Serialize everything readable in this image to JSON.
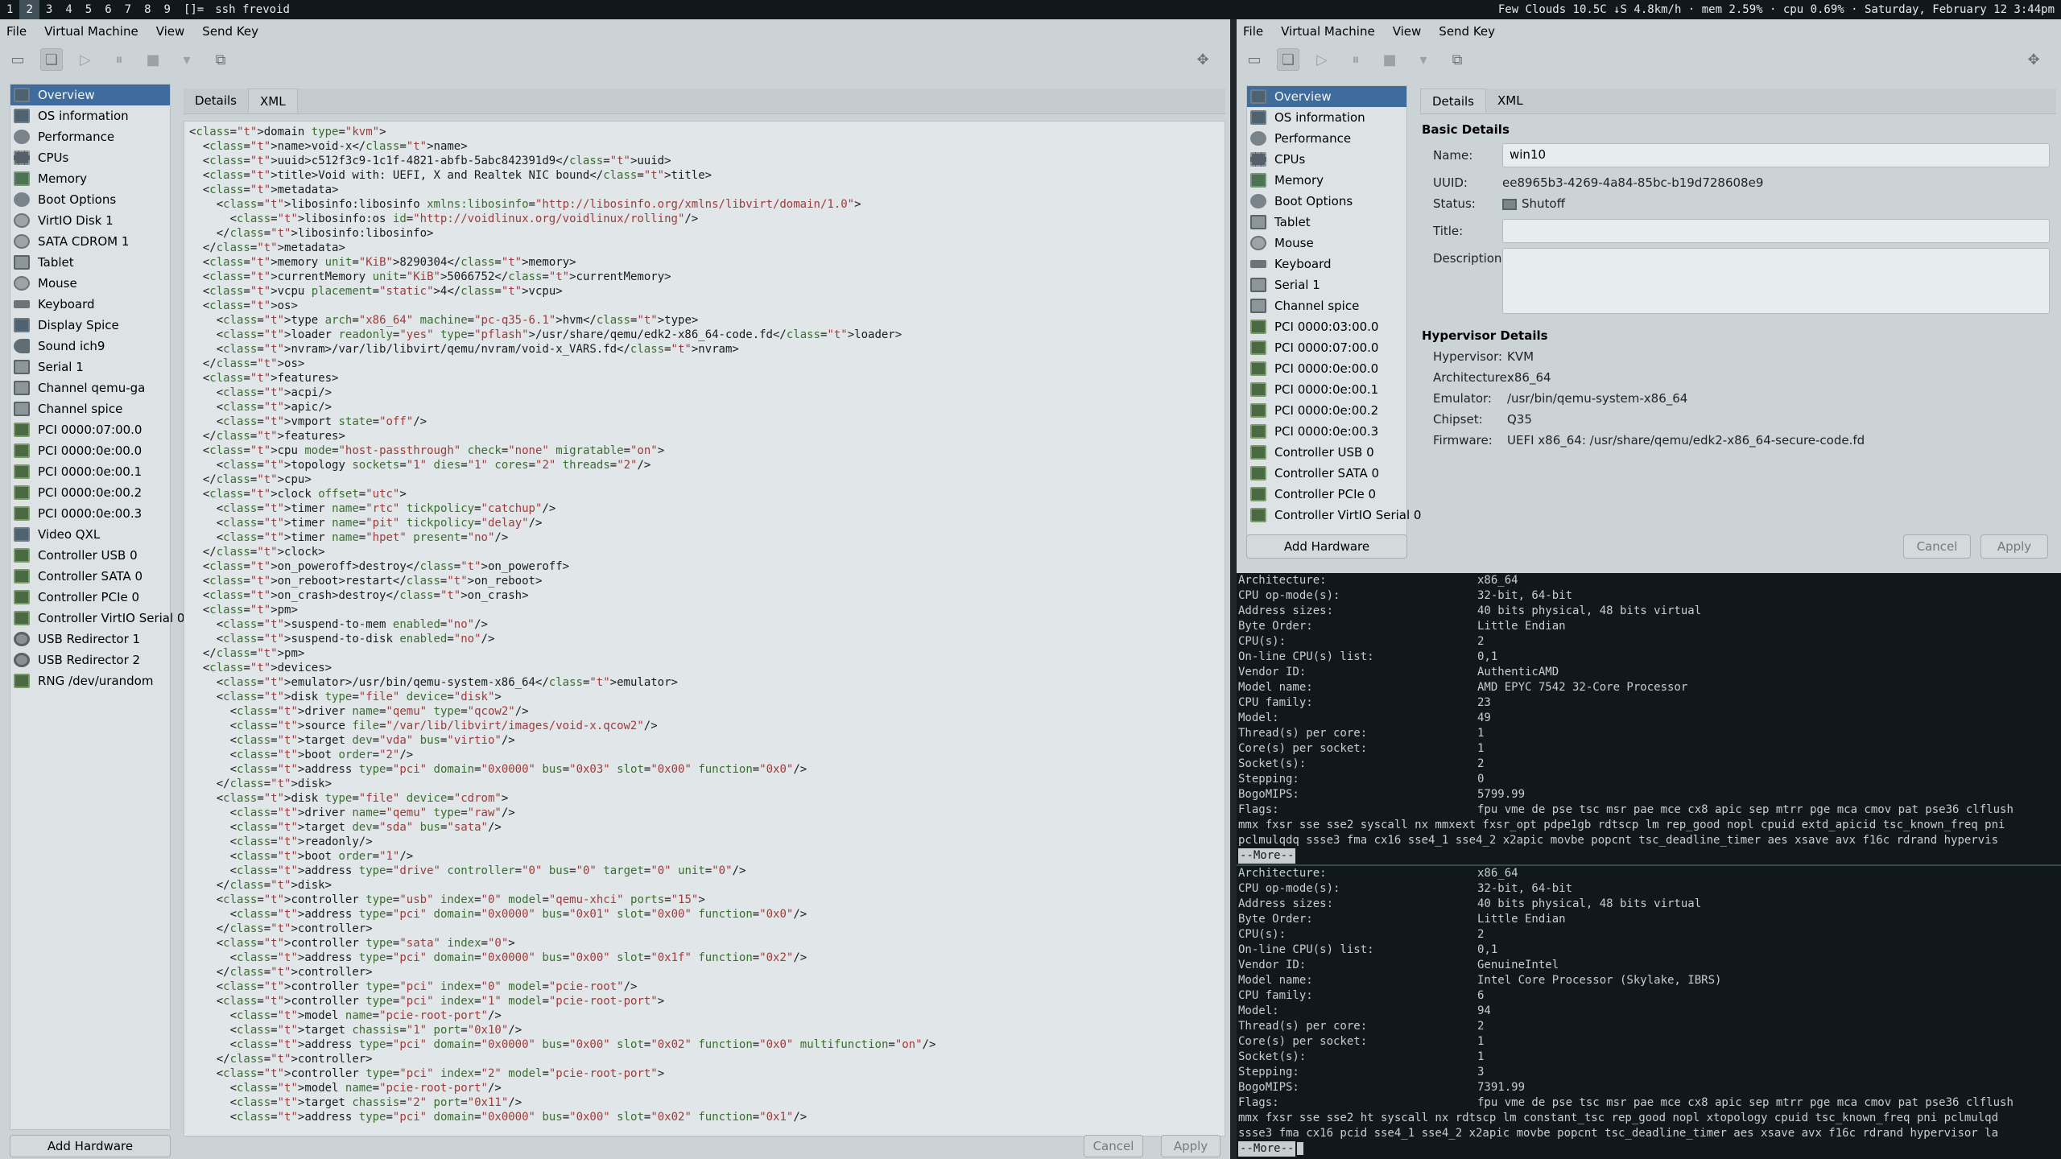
{
  "topbar": {
    "workspaces": [
      "1",
      "2",
      "3",
      "4",
      "5",
      "6",
      "7",
      "8",
      "9"
    ],
    "active_workspace": "2",
    "layout": "[]=",
    "title": "ssh frevoid",
    "status": "Few Clouds 10.5C ↓S 4.8km/h · mem 2.59% · cpu 0.69% · Saturday, February 12 3:44pm"
  },
  "left_window": {
    "menu": [
      "File",
      "Virtual Machine",
      "View",
      "Send Key"
    ],
    "sidebar": [
      "Overview",
      "OS information",
      "Performance",
      "CPUs",
      "Memory",
      "Boot Options",
      "VirtIO Disk 1",
      "SATA CDROM 1",
      "Tablet",
      "Mouse",
      "Keyboard",
      "Display Spice",
      "Sound ich9",
      "Serial 1",
      "Channel qemu-ga",
      "Channel spice",
      "PCI 0000:07:00.0",
      "PCI 0000:0e:00.0",
      "PCI 0000:0e:00.1",
      "PCI 0000:0e:00.2",
      "PCI 0000:0e:00.3",
      "Video QXL",
      "Controller USB 0",
      "Controller SATA 0",
      "Controller PCIe 0",
      "Controller VirtIO Serial 0",
      "USB Redirector 1",
      "USB Redirector 2",
      "RNG /dev/urandom"
    ],
    "tabs": [
      "Details",
      "XML"
    ],
    "active_tab": "XML",
    "add_hardware": "Add Hardware",
    "cancel": "Cancel",
    "apply": "Apply",
    "xml_lines": [
      "<domain type=\"kvm\">",
      "  <name>void-x</name>",
      "  <uuid>c512f3c9-1c1f-4821-abfb-5abc842391d9</uuid>",
      "  <title>Void with: UEFI, X and Realtek NIC bound</title>",
      "  <metadata>",
      "    <libosinfo:libosinfo xmlns:libosinfo=\"http://libosinfo.org/xmlns/libvirt/domain/1.0\">",
      "      <libosinfo:os id=\"http://voidlinux.org/voidlinux/rolling\"/>",
      "    </libosinfo:libosinfo>",
      "  </metadata>",
      "  <memory unit=\"KiB\">8290304</memory>",
      "  <currentMemory unit=\"KiB\">5066752</currentMemory>",
      "  <vcpu placement=\"static\">4</vcpu>",
      "  <os>",
      "    <type arch=\"x86_64\" machine=\"pc-q35-6.1\">hvm</type>",
      "    <loader readonly=\"yes\" type=\"pflash\">/usr/share/qemu/edk2-x86_64-code.fd</loader>",
      "    <nvram>/var/lib/libvirt/qemu/nvram/void-x_VARS.fd</nvram>",
      "  </os>",
      "  <features>",
      "    <acpi/>",
      "    <apic/>",
      "    <vmport state=\"off\"/>",
      "  </features>",
      "  <cpu mode=\"host-passthrough\" check=\"none\" migratable=\"on\">",
      "    <topology sockets=\"1\" dies=\"1\" cores=\"2\" threads=\"2\"/>",
      "  </cpu>",
      "  <clock offset=\"utc\">",
      "    <timer name=\"rtc\" tickpolicy=\"catchup\"/>",
      "    <timer name=\"pit\" tickpolicy=\"delay\"/>",
      "    <timer name=\"hpet\" present=\"no\"/>",
      "  </clock>",
      "  <on_poweroff>destroy</on_poweroff>",
      "  <on_reboot>restart</on_reboot>",
      "  <on_crash>destroy</on_crash>",
      "  <pm>",
      "    <suspend-to-mem enabled=\"no\"/>",
      "    <suspend-to-disk enabled=\"no\"/>",
      "  </pm>",
      "  <devices>",
      "    <emulator>/usr/bin/qemu-system-x86_64</emulator>",
      "    <disk type=\"file\" device=\"disk\">",
      "      <driver name=\"qemu\" type=\"qcow2\"/>",
      "      <source file=\"/var/lib/libvirt/images/void-x.qcow2\"/>",
      "      <target dev=\"vda\" bus=\"virtio\"/>",
      "      <boot order=\"2\"/>",
      "      <address type=\"pci\" domain=\"0x0000\" bus=\"0x03\" slot=\"0x00\" function=\"0x0\"/>",
      "    </disk>",
      "    <disk type=\"file\" device=\"cdrom\">",
      "      <driver name=\"qemu\" type=\"raw\"/>",
      "      <target dev=\"sda\" bus=\"sata\"/>",
      "      <readonly/>",
      "      <boot order=\"1\"/>",
      "      <address type=\"drive\" controller=\"0\" bus=\"0\" target=\"0\" unit=\"0\"/>",
      "    </disk>",
      "    <controller type=\"usb\" index=\"0\" model=\"qemu-xhci\" ports=\"15\">",
      "      <address type=\"pci\" domain=\"0x0000\" bus=\"0x01\" slot=\"0x00\" function=\"0x0\"/>",
      "    </controller>",
      "    <controller type=\"sata\" index=\"0\">",
      "      <address type=\"pci\" domain=\"0x0000\" bus=\"0x00\" slot=\"0x1f\" function=\"0x2\"/>",
      "    </controller>",
      "    <controller type=\"pci\" index=\"0\" model=\"pcie-root\"/>",
      "    <controller type=\"pci\" index=\"1\" model=\"pcie-root-port\">",
      "      <model name=\"pcie-root-port\"/>",
      "      <target chassis=\"1\" port=\"0x10\"/>",
      "      <address type=\"pci\" domain=\"0x0000\" bus=\"0x00\" slot=\"0x02\" function=\"0x0\" multifunction=\"on\"/>",
      "    </controller>",
      "    <controller type=\"pci\" index=\"2\" model=\"pcie-root-port\">",
      "      <model name=\"pcie-root-port\"/>",
      "      <target chassis=\"2\" port=\"0x11\"/>",
      "      <address type=\"pci\" domain=\"0x0000\" bus=\"0x00\" slot=\"0x02\" function=\"0x1\"/>"
    ]
  },
  "right_window": {
    "menu": [
      "File",
      "Virtual Machine",
      "View",
      "Send Key"
    ],
    "sidebar": [
      "Overview",
      "OS information",
      "Performance",
      "CPUs",
      "Memory",
      "Boot Options",
      "Tablet",
      "Mouse",
      "Keyboard",
      "Serial 1",
      "Channel spice",
      "PCI 0000:03:00.0",
      "PCI 0000:07:00.0",
      "PCI 0000:0e:00.0",
      "PCI 0000:0e:00.1",
      "PCI 0000:0e:00.2",
      "PCI 0000:0e:00.3",
      "Controller USB 0",
      "Controller SATA 0",
      "Controller PCIe 0",
      "Controller VirtIO Serial 0"
    ],
    "tabs": [
      "Details",
      "XML"
    ],
    "active_tab": "Details",
    "basic_title": "Basic Details",
    "name_label": "Name:",
    "name_value": "win10",
    "uuid_label": "UUID:",
    "uuid_value": "ee8965b3-4269-4a84-85bc-b19d728608e9",
    "status_label": "Status:",
    "status_value": "Shutoff",
    "title_label": "Title:",
    "title_value": "",
    "desc_label": "Description:",
    "desc_value": "",
    "hyper_title": "Hypervisor Details",
    "hypervisor_label": "Hypervisor:",
    "hypervisor_value": "KVM",
    "arch_label": "Architecture:",
    "arch_value": "x86_64",
    "emulator_label": "Emulator:",
    "emulator_value": "/usr/bin/qemu-system-x86_64",
    "chipset_label": "Chipset:",
    "chipset_value": "Q35",
    "firmware_label": "Firmware:",
    "firmware_value": "UEFI x86_64: /usr/share/qemu/edk2-x86_64-secure-code.fd",
    "add_hardware": "Add Hardware",
    "cancel": "Cancel",
    "apply": "Apply"
  },
  "terminal": {
    "block1": [
      [
        "Architecture:",
        "x86_64"
      ],
      [
        "CPU op-mode(s):",
        "32-bit, 64-bit"
      ],
      [
        "Address sizes:",
        "40 bits physical, 48 bits virtual"
      ],
      [
        "Byte Order:",
        "Little Endian"
      ],
      [
        "CPU(s):",
        "2"
      ],
      [
        "On-line CPU(s) list:",
        "0,1"
      ],
      [
        "Vendor ID:",
        "AuthenticAMD"
      ],
      [
        "Model name:",
        "AMD EPYC 7542 32-Core Processor"
      ],
      [
        "CPU family:",
        "23"
      ],
      [
        "Model:",
        "49"
      ],
      [
        "Thread(s) per core:",
        "1"
      ],
      [
        "Core(s) per socket:",
        "1"
      ],
      [
        "Socket(s):",
        "2"
      ],
      [
        "Stepping:",
        "0"
      ],
      [
        "BogoMIPS:",
        "5799.99"
      ],
      [
        "Flags:",
        "fpu vme de pse tsc msr pae mce cx8 apic sep mtrr pge mca cmov pat pse36 clflush"
      ]
    ],
    "block1_flags": [
      "mmx fxsr sse sse2 syscall nx mmxext fxsr_opt pdpe1gb rdtscp lm rep_good nopl cpuid extd_apicid tsc_known_freq pni",
      " pclmulqdq ssse3 fma cx16 sse4_1 sse4_2 x2apic movbe popcnt tsc_deadline_timer aes xsave avx f16c rdrand hypervis"
    ],
    "block2": [
      [
        "Architecture:",
        "x86_64"
      ],
      [
        "CPU op-mode(s):",
        "32-bit, 64-bit"
      ],
      [
        "Address sizes:",
        "40 bits physical, 48 bits virtual"
      ],
      [
        "Byte Order:",
        "Little Endian"
      ],
      [
        "CPU(s):",
        "2"
      ],
      [
        "On-line CPU(s) list:",
        "0,1"
      ],
      [
        "Vendor ID:",
        "GenuineIntel"
      ],
      [
        "Model name:",
        "Intel Core Processor (Skylake, IBRS)"
      ],
      [
        "CPU family:",
        "6"
      ],
      [
        "Model:",
        "94"
      ],
      [
        "Thread(s) per core:",
        "2"
      ],
      [
        "Core(s) per socket:",
        "1"
      ],
      [
        "Socket(s):",
        "1"
      ],
      [
        "Stepping:",
        "3"
      ],
      [
        "BogoMIPS:",
        "7391.99"
      ],
      [
        "Flags:",
        "fpu vme de pse tsc msr pae mce cx8 apic sep mtrr pge mca cmov pat pse36 clflush"
      ]
    ],
    "block2_flags": [
      "mmx fxsr sse sse2 ht syscall nx rdtscp lm constant_tsc rep_good nopl xtopology cpuid tsc_known_freq pni pclmulqd",
      " ssse3 fma cx16 pcid sse4_1 sse4_2 x2apic movbe popcnt tsc_deadline_timer aes xsave avx f16c rdrand hypervisor la"
    ],
    "more_prompt": "--More--"
  }
}
